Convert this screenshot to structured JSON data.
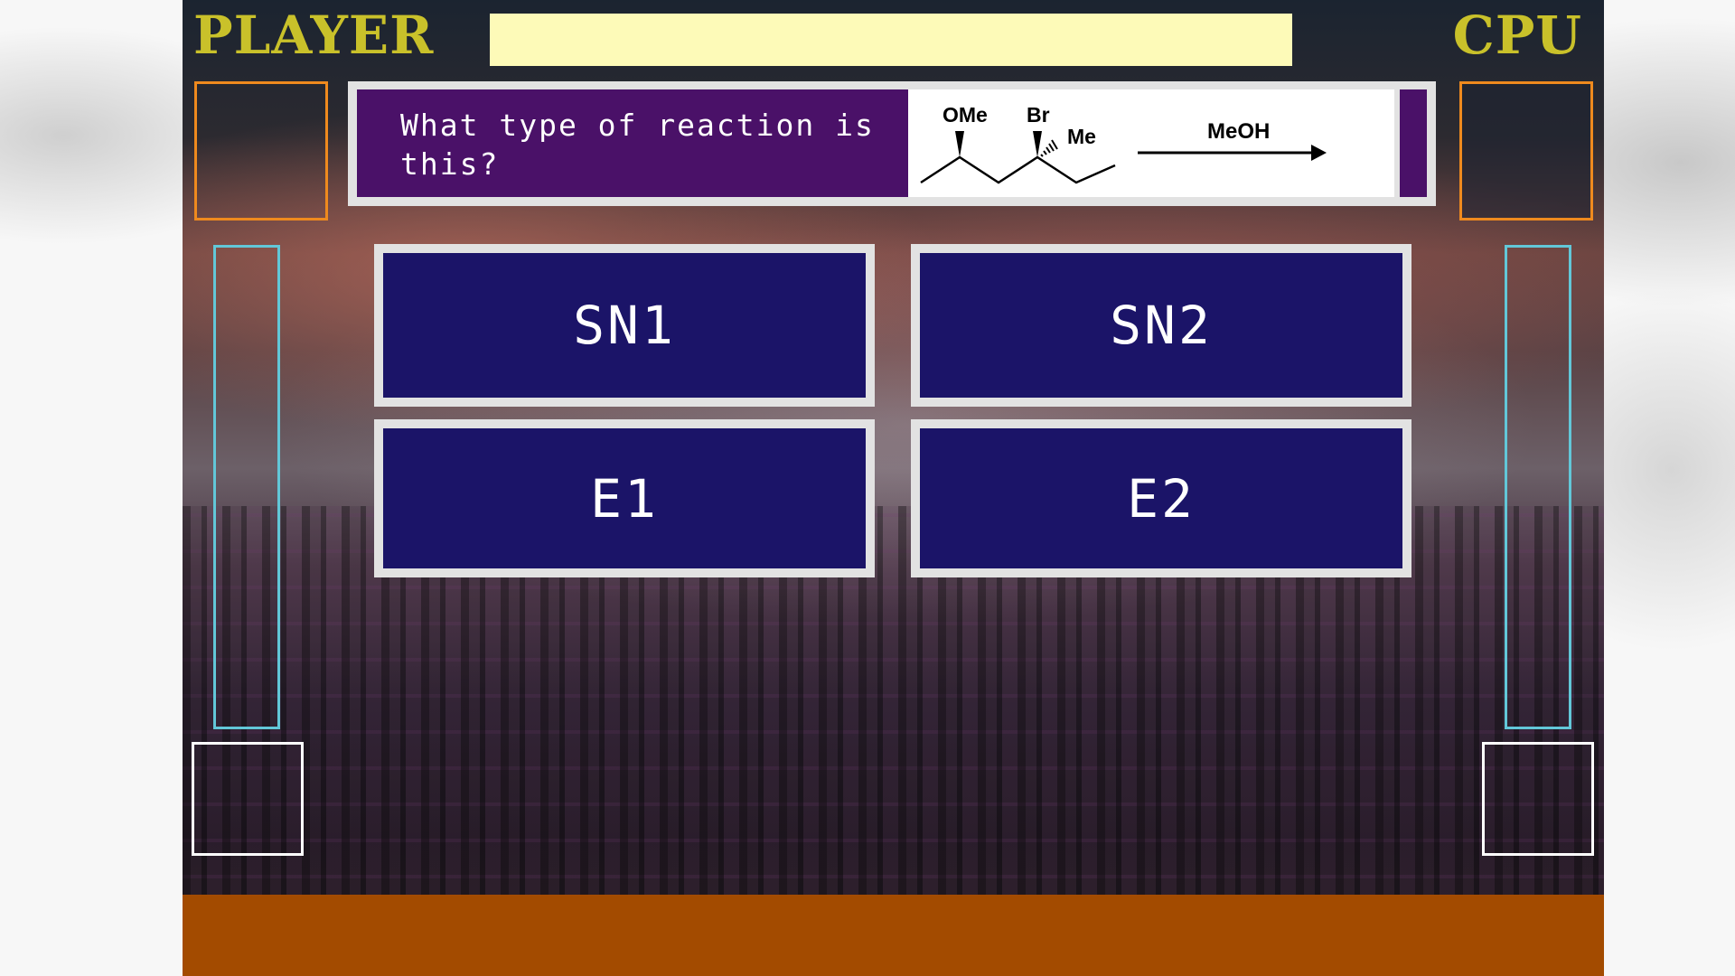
{
  "header": {
    "player_label": "PLAYER",
    "cpu_label": "CPU"
  },
  "question": {
    "text": "What type of reaction is this?",
    "image": {
      "substituent_1": "OMe",
      "substituent_2": "Br",
      "substituent_3": "Me",
      "reagent": "MeOH"
    }
  },
  "answers": [
    {
      "label": "SN1"
    },
    {
      "label": "SN2"
    },
    {
      "label": "E1"
    },
    {
      "label": "E2"
    }
  ],
  "colors": {
    "title": "#c9c12a",
    "progress_bar": "#fdfab8",
    "question_bg": "#4a1168",
    "answer_bg": "#1b1468",
    "answer_border": "#e2e2e2",
    "portrait_border": "#ef8a1e",
    "meter_border": "#62c7d8",
    "bottom_bar": "#a34b00"
  }
}
